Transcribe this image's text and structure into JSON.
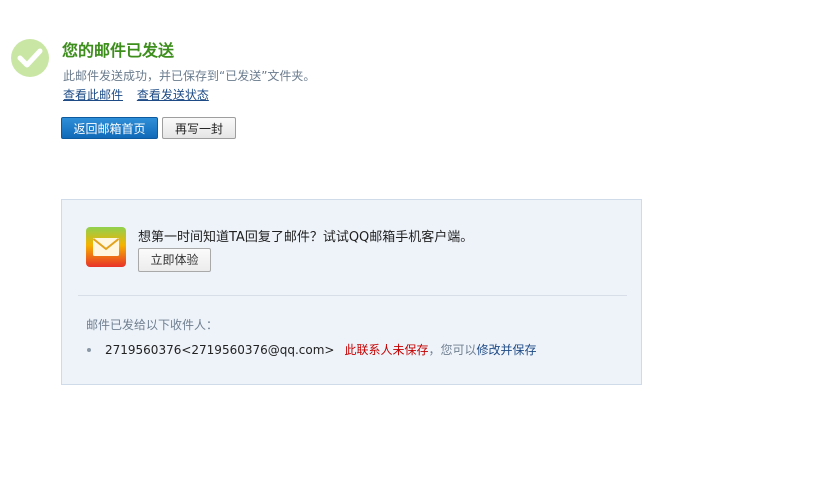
{
  "header": {
    "title": "您的邮件已发送",
    "subtitle": "此邮件发送成功，并已保存到“已发送”文件夹。",
    "links": {
      "view_mail": "查看此邮件",
      "view_status": "查看发送状态"
    },
    "icon": "checkmark-icon"
  },
  "actions": {
    "back_label": "返回邮箱首页",
    "compose_label": "再写一封"
  },
  "promo": {
    "icon": "mail-app-icon",
    "text": "想第一时间知道TA回复了邮件？试试QQ邮箱手机客户端。",
    "try_label": "立即体验"
  },
  "recipients": {
    "label": "邮件已发给以下收件人：",
    "items": [
      {
        "email": "2719560376<2719560376@qq.com>",
        "status": "此联系人未保存",
        "hint": "，您可以",
        "action": "修改并保存"
      }
    ]
  },
  "colors": {
    "success_green": "#3d8e1c",
    "link_blue": "#1e4b86",
    "primary_button": "#1069b8",
    "warning_red": "#c40000",
    "promo_bg": "#eef3fa"
  }
}
